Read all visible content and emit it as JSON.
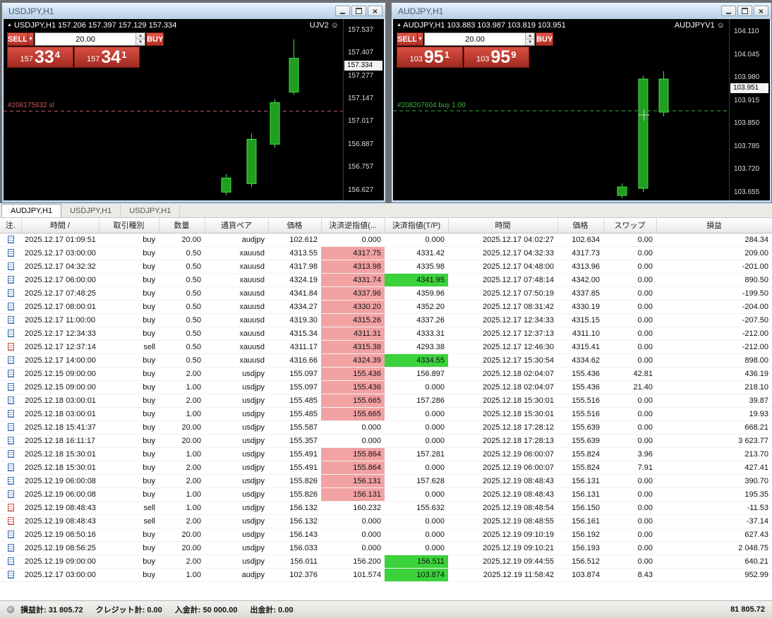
{
  "icons": {
    "smiley": "☺",
    "dropdown": "▼",
    "spin_up": "▲",
    "spin_down": "▼",
    "close": "×",
    "sort": "/",
    "shift_marker": "▲"
  },
  "charts": [
    {
      "window_title": "USDJPY,H1",
      "info": "USDJPY,H1 157.206 157.397 157.129 157.334",
      "ea_label": "UJV2",
      "panel": {
        "sell_label": "SELL",
        "buy_label": "BUY",
        "volume": "20.00",
        "sell_small": "157",
        "sell_big": "33",
        "sell_sup": "4",
        "buy_small": "157",
        "buy_big": "34",
        "buy_sup": "1"
      }
    },
    {
      "window_title": "AUDJPY,H1",
      "info": "AUDJPY,H1 103.883 103.987 103.819 103.951",
      "ea_label": "AUDJPYV1",
      "panel": {
        "sell_label": "SELL",
        "buy_label": "BUY",
        "volume": "20.00",
        "sell_small": "103",
        "sell_big": "95",
        "sell_sup": "1",
        "buy_small": "103",
        "buy_big": "95",
        "buy_sup": "9"
      }
    }
  ],
  "chart_data": [
    {
      "type": "candlestick",
      "symbol": "USDJPY,H1",
      "price_min": 156.57,
      "price_max": 157.6,
      "axis_labels": [
        "157.537",
        "157.407",
        "157.277",
        "157.147",
        "157.017",
        "156.887",
        "156.757",
        "156.627"
      ],
      "bid": 157.334,
      "bid_label": "157.334",
      "up_color": "#45e045",
      "up_fill": "#1f9e1f",
      "candles": [
        {
          "x": 0.654,
          "o": 156.617,
          "h": 156.72,
          "l": 156.6,
          "c": 156.697
        },
        {
          "x": 0.729,
          "o": 156.665,
          "h": 156.95,
          "l": 156.645,
          "c": 156.917
        },
        {
          "x": 0.799,
          "o": 156.889,
          "h": 157.145,
          "l": 156.869,
          "c": 157.125
        },
        {
          "x": 0.855,
          "o": 157.185,
          "h": 157.485,
          "l": 157.169,
          "c": 157.377
        }
      ],
      "hlines": [
        {
          "price": 157.077,
          "color": "#c15b5b",
          "style": "dashed",
          "label": "#208175632 sl"
        }
      ]
    },
    {
      "type": "candlestick",
      "symbol": "AUDJPY,H1",
      "price_min": 103.632,
      "price_max": 104.146,
      "axis_labels": [
        "104.110",
        "104.045",
        "103.980",
        "103.915",
        "103.850",
        "103.785",
        "103.720",
        "103.655"
      ],
      "bid": 103.951,
      "bid_label": "103.951",
      "up_color": "#45e045",
      "up_fill": "#1f9e1f",
      "candles": [
        {
          "x": 0.68,
          "o": 103.646,
          "h": 103.68,
          "l": 103.638,
          "c": 103.67
        },
        {
          "x": 0.743,
          "o": 103.666,
          "h": 103.985,
          "l": 103.655,
          "c": 103.976
        },
        {
          "x": 0.805,
          "o": 103.882,
          "h": 103.998,
          "l": 103.87,
          "c": 103.976
        }
      ],
      "hlines": [
        {
          "price": 103.886,
          "color": "#3db53d",
          "style": "dashed",
          "label": "#208207604 buy 1.00"
        }
      ],
      "crosshair": {
        "x": 0.747,
        "price": 103.874
      }
    }
  ],
  "tabs": [
    {
      "label": "AUDJPY,H1",
      "active": true
    },
    {
      "label": "USDJPY,H1",
      "active": false
    },
    {
      "label": "USDJPY,H1",
      "active": false
    }
  ],
  "table": {
    "columns": [
      {
        "key": "note",
        "label": "注."
      },
      {
        "key": "open_time",
        "label": "時間",
        "sort": true
      },
      {
        "key": "type",
        "label": "取引種別"
      },
      {
        "key": "volume",
        "label": "数量"
      },
      {
        "key": "symbol",
        "label": "通貨ペア"
      },
      {
        "key": "open_price",
        "label": "価格"
      },
      {
        "key": "sl",
        "label": "決済逆指値(..."
      },
      {
        "key": "tp",
        "label": "決済指値(T/P)"
      },
      {
        "key": "close_time",
        "label": "時間"
      },
      {
        "key": "close_price",
        "label": "価格"
      },
      {
        "key": "swap",
        "label": "スワップ"
      },
      {
        "key": "profit",
        "label": "損益"
      }
    ],
    "rows": [
      {
        "open_time": "2025.12.17 01:09:51",
        "type": "buy",
        "volume": "20.00",
        "symbol": "audjpy",
        "open_price": "102.612",
        "sl": "0.000",
        "sl_hl": false,
        "tp": "0.000",
        "tp_hl": false,
        "close_time": "2025.12.17 04:02:27",
        "close_price": "102.634",
        "swap": "0.00",
        "profit": "284.34"
      },
      {
        "open_time": "2025.12.17 03:00:00",
        "type": "buy",
        "volume": "0.50",
        "symbol": "xauusd",
        "open_price": "4313.55",
        "sl": "4317.75",
        "sl_hl": true,
        "tp": "4331.42",
        "tp_hl": false,
        "close_time": "2025.12.17 04:32:33",
        "close_price": "4317.73",
        "swap": "0.00",
        "profit": "209.00"
      },
      {
        "open_time": "2025.12.17 04:32:32",
        "type": "buy",
        "volume": "0.50",
        "symbol": "xauusd",
        "open_price": "4317.98",
        "sl": "4313.98",
        "sl_hl": true,
        "tp": "4335.98",
        "tp_hl": false,
        "close_time": "2025.12.17 04:48:00",
        "close_price": "4313.96",
        "swap": "0.00",
        "profit": "-201.00"
      },
      {
        "open_time": "2025.12.17 06:00:00",
        "type": "buy",
        "volume": "0.50",
        "symbol": "xauusd",
        "open_price": "4324.19",
        "sl": "4331.74",
        "sl_hl": true,
        "tp": "4341.95",
        "tp_hl": true,
        "close_time": "2025.12.17 07:48:14",
        "close_price": "4342.00",
        "swap": "0.00",
        "profit": "890.50"
      },
      {
        "open_time": "2025.12.17 07:48:25",
        "type": "buy",
        "volume": "0.50",
        "symbol": "xauusd",
        "open_price": "4341.84",
        "sl": "4337.96",
        "sl_hl": true,
        "tp": "4359.96",
        "tp_hl": false,
        "close_time": "2025.12.17 07:50:19",
        "close_price": "4337.85",
        "swap": "0.00",
        "profit": "-199.50"
      },
      {
        "open_time": "2025.12.17 08:00:01",
        "type": "buy",
        "volume": "0.50",
        "symbol": "xauusd",
        "open_price": "4334.27",
        "sl": "4330.20",
        "sl_hl": true,
        "tp": "4352.20",
        "tp_hl": false,
        "close_time": "2025.12.17 08:31:42",
        "close_price": "4330.19",
        "swap": "0.00",
        "profit": "-204.00"
      },
      {
        "open_time": "2025.12.17 11:00:00",
        "type": "buy",
        "volume": "0.50",
        "symbol": "xauusd",
        "open_price": "4319.30",
        "sl": "4315.26",
        "sl_hl": true,
        "tp": "4337.26",
        "tp_hl": false,
        "close_time": "2025.12.17 12:34:33",
        "close_price": "4315.15",
        "swap": "0.00",
        "profit": "-207.50"
      },
      {
        "open_time": "2025.12.17 12:34:33",
        "type": "buy",
        "volume": "0.50",
        "symbol": "xauusd",
        "open_price": "4315.34",
        "sl": "4311.31",
        "sl_hl": true,
        "tp": "4333.31",
        "tp_hl": false,
        "close_time": "2025.12.17 12:37:13",
        "close_price": "4311.10",
        "swap": "0.00",
        "profit": "-212.00"
      },
      {
        "open_time": "2025.12.17 12:37:14",
        "type": "sell",
        "volume": "0.50",
        "symbol": "xauusd",
        "open_price": "4311.17",
        "sl": "4315.38",
        "sl_hl": true,
        "tp": "4293.38",
        "tp_hl": false,
        "close_time": "2025.12.17 12:46:30",
        "close_price": "4315.41",
        "swap": "0.00",
        "profit": "-212.00"
      },
      {
        "open_time": "2025.12.17 14:00:00",
        "type": "buy",
        "volume": "0.50",
        "symbol": "xauusd",
        "open_price": "4316.66",
        "sl": "4324.39",
        "sl_hl": true,
        "tp": "4334.55",
        "tp_hl": true,
        "close_time": "2025.12.17 15:30:54",
        "close_price": "4334.62",
        "swap": "0.00",
        "profit": "898.00"
      },
      {
        "open_time": "2025.12.15 09:00:00",
        "type": "buy",
        "volume": "2.00",
        "symbol": "usdjpy",
        "open_price": "155.097",
        "sl": "155.436",
        "sl_hl": true,
        "tp": "156.897",
        "tp_hl": false,
        "close_time": "2025.12.18 02:04:07",
        "close_price": "155.436",
        "swap": "42.81",
        "profit": "436.19"
      },
      {
        "open_time": "2025.12.15 09:00:00",
        "type": "buy",
        "volume": "1.00",
        "symbol": "usdjpy",
        "open_price": "155.097",
        "sl": "155.436",
        "sl_hl": true,
        "tp": "0.000",
        "tp_hl": false,
        "close_time": "2025.12.18 02:04:07",
        "close_price": "155.436",
        "swap": "21.40",
        "profit": "218.10"
      },
      {
        "open_time": "2025.12.18 03:00:01",
        "type": "buy",
        "volume": "2.00",
        "symbol": "usdjpy",
        "open_price": "155.485",
        "sl": "155.665",
        "sl_hl": true,
        "tp": "157.286",
        "tp_hl": false,
        "close_time": "2025.12.18 15:30:01",
        "close_price": "155.516",
        "swap": "0.00",
        "profit": "39.87"
      },
      {
        "open_time": "2025.12.18 03:00:01",
        "type": "buy",
        "volume": "1.00",
        "symbol": "usdjpy",
        "open_price": "155.485",
        "sl": "155.665",
        "sl_hl": true,
        "tp": "0.000",
        "tp_hl": false,
        "close_time": "2025.12.18 15:30:01",
        "close_price": "155.516",
        "swap": "0.00",
        "profit": "19.93"
      },
      {
        "open_time": "2025.12.18 15:41:37",
        "type": "buy",
        "volume": "20.00",
        "symbol": "usdjpy",
        "open_price": "155.587",
        "sl": "0.000",
        "sl_hl": false,
        "tp": "0.000",
        "tp_hl": false,
        "close_time": "2025.12.18 17:28:12",
        "close_price": "155.639",
        "swap": "0.00",
        "profit": "668.21"
      },
      {
        "open_time": "2025.12.18 16:11:17",
        "type": "buy",
        "volume": "20.00",
        "symbol": "usdjpy",
        "open_price": "155.357",
        "sl": "0.000",
        "sl_hl": false,
        "tp": "0.000",
        "tp_hl": false,
        "close_time": "2025.12.18 17:28:13",
        "close_price": "155.639",
        "swap": "0.00",
        "profit": "3 623.77"
      },
      {
        "open_time": "2025.12.18 15:30:01",
        "type": "buy",
        "volume": "1.00",
        "symbol": "usdjpy",
        "open_price": "155.491",
        "sl": "155.864",
        "sl_hl": true,
        "tp": "157.281",
        "tp_hl": false,
        "close_time": "2025.12.19 06:00:07",
        "close_price": "155.824",
        "swap": "3.96",
        "profit": "213.70"
      },
      {
        "open_time": "2025.12.18 15:30:01",
        "type": "buy",
        "volume": "2.00",
        "symbol": "usdjpy",
        "open_price": "155.491",
        "sl": "155.864",
        "sl_hl": true,
        "tp": "0.000",
        "tp_hl": false,
        "close_time": "2025.12.19 06:00:07",
        "close_price": "155.824",
        "swap": "7.91",
        "profit": "427.41"
      },
      {
        "open_time": "2025.12.19 06:00:08",
        "type": "buy",
        "volume": "2.00",
        "symbol": "usdjpy",
        "open_price": "155.826",
        "sl": "156.131",
        "sl_hl": true,
        "tp": "157.628",
        "tp_hl": false,
        "close_time": "2025.12.19 08:48:43",
        "close_price": "156.131",
        "swap": "0.00",
        "profit": "390.70"
      },
      {
        "open_time": "2025.12.19 06:00:08",
        "type": "buy",
        "volume": "1.00",
        "symbol": "usdjpy",
        "open_price": "155.826",
        "sl": "156.131",
        "sl_hl": true,
        "tp": "0.000",
        "tp_hl": false,
        "close_time": "2025.12.19 08:48:43",
        "close_price": "156.131",
        "swap": "0.00",
        "profit": "195.35"
      },
      {
        "open_time": "2025.12.19 08:48:43",
        "type": "sell",
        "volume": "1.00",
        "symbol": "usdjpy",
        "open_price": "156.132",
        "sl": "160.232",
        "sl_hl": false,
        "tp": "155.632",
        "tp_hl": false,
        "close_time": "2025.12.19 08:48:54",
        "close_price": "156.150",
        "swap": "0.00",
        "profit": "-11.53"
      },
      {
        "open_time": "2025.12.19 08:48:43",
        "type": "sell",
        "volume": "2.00",
        "symbol": "usdjpy",
        "open_price": "156.132",
        "sl": "0.000",
        "sl_hl": false,
        "tp": "0.000",
        "tp_hl": false,
        "close_time": "2025.12.19 08:48:55",
        "close_price": "156.161",
        "swap": "0.00",
        "profit": "-37.14"
      },
      {
        "open_time": "2025.12.19 08:50:16",
        "type": "buy",
        "volume": "20.00",
        "symbol": "usdjpy",
        "open_price": "156.143",
        "sl": "0.000",
        "sl_hl": false,
        "tp": "0.000",
        "tp_hl": false,
        "close_time": "2025.12.19 09:10:19",
        "close_price": "156.192",
        "swap": "0.00",
        "profit": "627.43"
      },
      {
        "open_time": "2025.12.19 08:56:25",
        "type": "buy",
        "volume": "20.00",
        "symbol": "usdjpy",
        "open_price": "156.033",
        "sl": "0.000",
        "sl_hl": false,
        "tp": "0.000",
        "tp_hl": false,
        "close_time": "2025.12.19 09:10:21",
        "close_price": "156.193",
        "swap": "0.00",
        "profit": "2 048.75"
      },
      {
        "open_time": "2025.12.19 09:00:00",
        "type": "buy",
        "volume": "2.00",
        "symbol": "usdjpy",
        "open_price": "156.011",
        "sl": "156.200",
        "sl_hl": false,
        "tp": "156.511",
        "tp_hl": true,
        "close_time": "2025.12.19 09:44:55",
        "close_price": "156.512",
        "swap": "0.00",
        "profit": "640.21"
      },
      {
        "open_time": "2025.12.17 03:00:00",
        "type": "buy",
        "volume": "1.00",
        "symbol": "audjpy",
        "open_price": "102.376",
        "sl": "101.574",
        "sl_hl": false,
        "tp": "103.874",
        "tp_hl": true,
        "close_time": "2025.12.19 11:58:42",
        "close_price": "103.874",
        "swap": "8.43",
        "profit": "952.99"
      }
    ]
  },
  "statusbar": {
    "items": [
      "損益計: 31 805.72",
      "クレジット計: 0.00",
      "入金計: 50 000.00",
      "出金計: 0.00"
    ],
    "balance": "81 805.72"
  }
}
